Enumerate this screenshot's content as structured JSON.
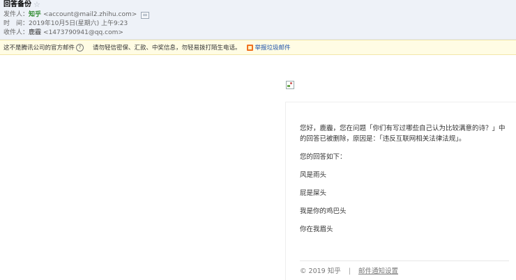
{
  "header": {
    "subject": "回答备份",
    "from_label": "发件人：",
    "from_name": "知乎",
    "from_addr": "<account@mail2.zhihu.com>",
    "time_label": "时　间：",
    "time_value": "2019年10月5日(星期六) 上午9:23",
    "to_label": "收件人：",
    "to_name": "鹿霾",
    "to_addr": "<1473790941@qq.com>"
  },
  "warning": {
    "main": "这不是腾讯公司的官方邮件",
    "tip": "请勿轻信密保、汇款、中奖信息，勿轻易拨打陌生电话。",
    "report_label": "举报垃圾邮件"
  },
  "body": {
    "line1": "您好，鹿霾，您在问题「你们有写过哪些自己认为比较满意的诗？」中",
    "line2": "的回答已被删除，原因是：「违反互联网相关法律法规」。",
    "intro": "您的回答如下：",
    "poem": [
      "风是雨头",
      "屁是屎头",
      "我是你的鸡巴头",
      "你在我眉头"
    ]
  },
  "footer": {
    "copyright": "© 2019 知乎",
    "separator": "|",
    "settings_link": "邮件通知设置"
  }
}
